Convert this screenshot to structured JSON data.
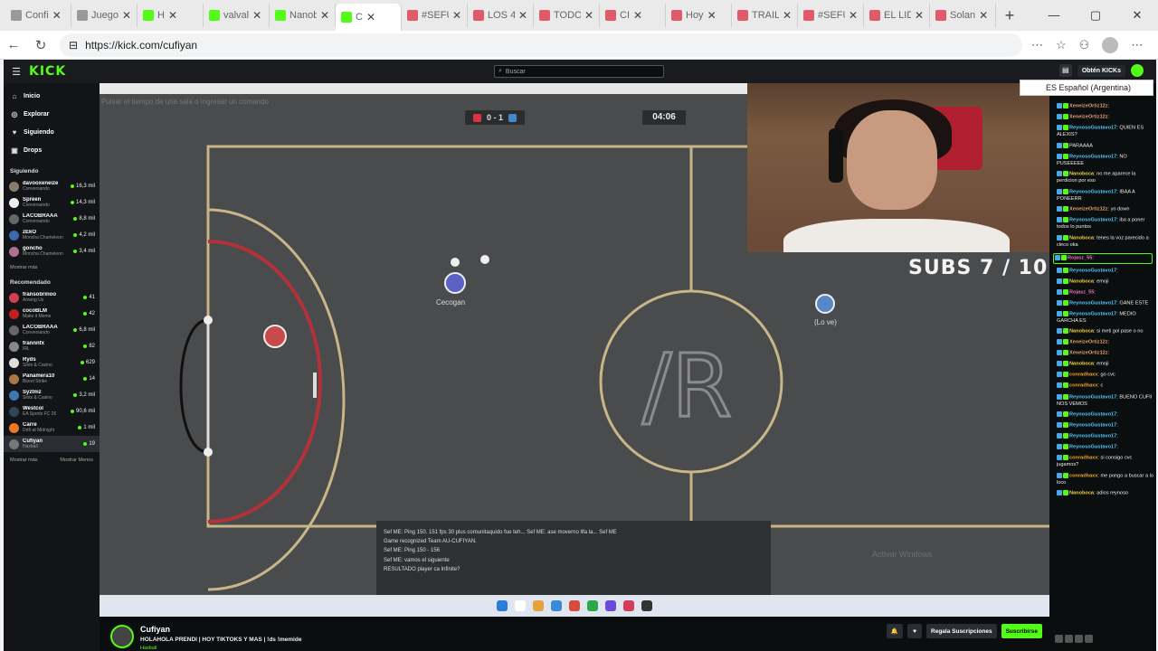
{
  "browser": {
    "tabs": [
      {
        "label": "Confi",
        "color": "#999999"
      },
      {
        "label": "Juego",
        "color": "#999999"
      },
      {
        "label": "H",
        "color": "#53fc18"
      },
      {
        "label": "valval",
        "color": "#53fc18"
      },
      {
        "label": "Nanob",
        "color": "#53fc18"
      },
      {
        "label": "C",
        "color": "#53fc18"
      },
      {
        "label": "#SEFU",
        "color": "#e05a6a"
      },
      {
        "label": "LOS 4",
        "color": "#e05a6a"
      },
      {
        "label": "TODO",
        "color": "#e05a6a"
      },
      {
        "label": "CI",
        "color": "#e05a6a"
      },
      {
        "label": "Hoy",
        "color": "#e05a6a"
      },
      {
        "label": "TRAIL",
        "color": "#e05a6a"
      },
      {
        "label": "#SEFU",
        "color": "#e05a6a"
      },
      {
        "label": "EL LID",
        "color": "#e05a6a"
      },
      {
        "label": "Solan",
        "color": "#e05a6a"
      }
    ],
    "url": "https://kick.com/cufiyan"
  },
  "kick": {
    "logo": "KICK",
    "search_placeholder": "Buscar",
    "get_kicks": "Obtén KICKs",
    "nav": [
      "Inicio",
      "Explorar",
      "Siguiendo",
      "Drops"
    ],
    "following_header": "Siguiendo",
    "following": [
      {
        "name": "davooxeneize",
        "cat": "Conversando",
        "viewers": "16,3 mil",
        "color": "#8a7a6a"
      },
      {
        "name": "Spreen",
        "cat": "Conversando",
        "viewers": "14,3 mil",
        "color": "#eeeeee"
      },
      {
        "name": "LACOBRAAA",
        "cat": "Conversando",
        "viewers": "8,8 mil",
        "color": "#666666"
      },
      {
        "name": "zEkO",
        "cat": "Moncha Chameleon",
        "viewers": "4,2 mil",
        "color": "#3a6ab0"
      },
      {
        "name": "goncho",
        "cat": "Moncha Chameleon",
        "viewers": "3,4 mil",
        "color": "#b07090"
      }
    ],
    "show_more": "Mostrar más",
    "recommended_header": "Recomendado",
    "recommended": [
      {
        "name": "fransobrinoo",
        "cat": "Among Us",
        "viewers": "41",
        "color": "#d04050"
      },
      {
        "name": "cocoBLM",
        "cat": "Make it Meme",
        "viewers": "42",
        "color": "#c02020"
      },
      {
        "name": "LACOBRAAA",
        "cat": "Conversando",
        "viewers": "6,8 mil",
        "color": "#666666"
      },
      {
        "name": "frannnfx",
        "cat": "IRL",
        "viewers": "82",
        "color": "#888888"
      },
      {
        "name": "Ryds",
        "cat": "Slots & Casino",
        "viewers": "629",
        "color": "#dddddd"
      },
      {
        "name": "Panamera10",
        "cat": "Blood Strike",
        "viewers": "14",
        "color": "#aa7744"
      },
      {
        "name": "Syztmz",
        "cat": "Slots & Casino",
        "viewers": "3,2 mil",
        "color": "#3a7ab0"
      },
      {
        "name": "Westcol",
        "cat": "EA Sports FC 26",
        "viewers": "90,6 mil",
        "color": "#334455"
      },
      {
        "name": "Carre",
        "cat": "Drift at Midnight",
        "viewers": "1 mil",
        "color": "#ee7722"
      },
      {
        "name": "Cufiyan",
        "cat": "Haxball",
        "viewers": "19",
        "color": "#777777"
      }
    ],
    "show_more2": "Mostrar más",
    "show_less": "Mostrar Menos"
  },
  "video": {
    "hint": "Pulsar el tiempo de una sala o ingresar un comando",
    "timer": "04:06",
    "subs": "SUBS 7 / 10",
    "player1": "Cecogan",
    "player2": "(Lo ve)",
    "chat_lines": [
      "Sef ME: Ping 150. 151 fps 30 plus comunitaquido fue teh... Sef ME: ase moverno lifa la... Sef ME",
      "Game recognized Team AU-CUFIYAN.",
      "Sef ME: Ping 150 - 156",
      "Sef ME: vamos el siguiente",
      "RESULTADO player ca Infinite?"
    ],
    "watermark": "Activar Windows",
    "tooltip": "ES Español (Argentina)"
  },
  "stream": {
    "name": "Cufiyan",
    "title": "HOLAHOLA PRENDI | HOY TIKTOKS Y MAS | !ds !memide",
    "category": "Haxball",
    "gift_subs": "Regala Suscripciones",
    "subscribe": "Suscribirse"
  },
  "chat": [
    {
      "user": "XeneizeOrtiz12z",
      "text": "",
      "color": "#e8a070"
    },
    {
      "user": "XeneizeOrtiz12z",
      "text": "",
      "color": "#e8a070"
    },
    {
      "user": "ReynosoGustavo17",
      "text": "QUIEN ES ALEXIS?",
      "color": "#53c8fc"
    },
    {
      "user": "",
      "text": "PARAAAA",
      "color": "#53c8fc"
    },
    {
      "user": "ReynosoGustavo17",
      "text": "NO PUSEEEEE",
      "color": "#53c8fc"
    },
    {
      "user": "Nanoboca",
      "text": "no me aparece la perdicion por eso",
      "color": "#f0d040"
    },
    {
      "user": "ReynosoGustavo17",
      "text": "IBAA A PONEERR",
      "color": "#53c8fc"
    },
    {
      "user": "XeneizeOrtiz12z",
      "text": "yo down",
      "color": "#e8a070"
    },
    {
      "user": "ReynosoGustavo17",
      "text": "iba a poner todos lo puntos",
      "color": "#53c8fc"
    },
    {
      "user": "Nanoboca",
      "text": "tenes la voz parecido a cleco oka",
      "color": "#f0d040"
    },
    {
      "user": "Rojasz_55",
      "text": "",
      "color": "#f070c0"
    },
    {
      "user": "ReynosoGustavo17",
      "text": "",
      "color": "#53c8fc"
    },
    {
      "user": "Nanoboca",
      "text": "emoji",
      "color": "#f0d040"
    },
    {
      "user": "Rojasz_55",
      "text": "",
      "color": "#f070c0"
    },
    {
      "user": "ReynosoGustavo17",
      "text": "GANE ESTE",
      "color": "#53c8fc"
    },
    {
      "user": "ReynosoGustavo17",
      "text": "MEDIO GARCHA ES",
      "color": "#53c8fc"
    },
    {
      "user": "Nanoboca",
      "text": "si meti gol pase o no",
      "color": "#f0d040"
    },
    {
      "user": "XeneizeOrtiz12z",
      "text": "",
      "color": "#e8a070"
    },
    {
      "user": "XeneizeOrtiz12z",
      "text": "",
      "color": "#e8a070"
    },
    {
      "user": "Nanoboca",
      "text": "emoji",
      "color": "#f0d040"
    },
    {
      "user": "conradhaxx",
      "text": "go cvc",
      "color": "#f0a030"
    },
    {
      "user": "conradhaxx",
      "text": "c",
      "color": "#f0a030"
    },
    {
      "user": "ReynosoGustavo17",
      "text": "BUENO CUFII NOS VEMOS",
      "color": "#53c8fc"
    },
    {
      "user": "ReynosoGustavo17",
      "text": "",
      "color": "#53c8fc"
    },
    {
      "user": "ReynosoGustavo17",
      "text": "",
      "color": "#53c8fc"
    },
    {
      "user": "ReynosoGustavo17",
      "text": "",
      "color": "#53c8fc"
    },
    {
      "user": "ReynosoGustavo17",
      "text": "",
      "color": "#53c8fc"
    },
    {
      "user": "conradhaxx",
      "text": "si consigo cvc jugamos?",
      "color": "#f0a030"
    },
    {
      "user": "conradhaxx",
      "text": "me pongo a buscar a lo loco",
      "color": "#f0a030"
    },
    {
      "user": "Nanoboca",
      "text": "adios reynoso",
      "color": "#f0d040"
    }
  ]
}
